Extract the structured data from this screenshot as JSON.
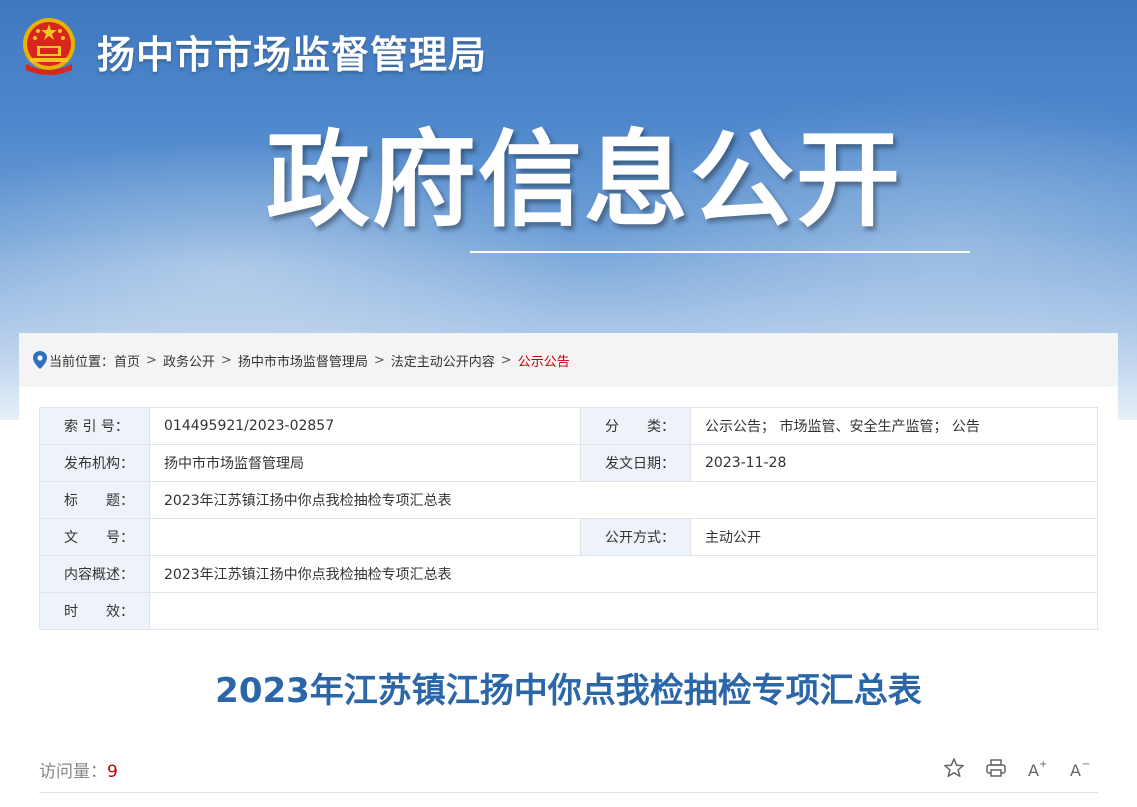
{
  "header": {
    "site_name": "扬中市市场监督管理局",
    "section_title": "政府信息公开"
  },
  "breadcrumb": {
    "prefix": "当前位置：",
    "items": [
      "首页",
      "政务公开",
      "扬中市市场监督管理局",
      "法定主动公开内容",
      "公示公告"
    ],
    "separator": ">"
  },
  "meta": {
    "index_label": "索 引 号：",
    "index_value": "014495921/2023-02857",
    "category_label": "分　　类：",
    "category_value": "公示公告； 市场监管、安全生产监管； 公告",
    "publisher_label": "发布机构：",
    "publisher_value": "扬中市市场监督管理局",
    "date_label": "发文日期：",
    "date_value": "2023-11-28",
    "title_label": "标　　题：",
    "title_value": "2023年江苏镇江扬中你点我检抽检专项汇总表",
    "docno_label": "文　　号：",
    "docno_value": "",
    "method_label": "公开方式：",
    "method_value": "主动公开",
    "summary_label": "内容概述：",
    "summary_value": "2023年江苏镇江扬中你点我检抽检专项汇总表",
    "validity_label": "时　　效：",
    "validity_value": ""
  },
  "article": {
    "title": "2023年江苏镇江扬中你点我检抽检专项汇总表",
    "visits_label": "访问量：",
    "visits_count": "9"
  },
  "tools": {
    "font_up": "A⁺",
    "font_down": "A⁻"
  },
  "colors": {
    "accent_blue": "#2a66a8",
    "active_red": "#c00000",
    "label_bg": "#eef3fa"
  }
}
